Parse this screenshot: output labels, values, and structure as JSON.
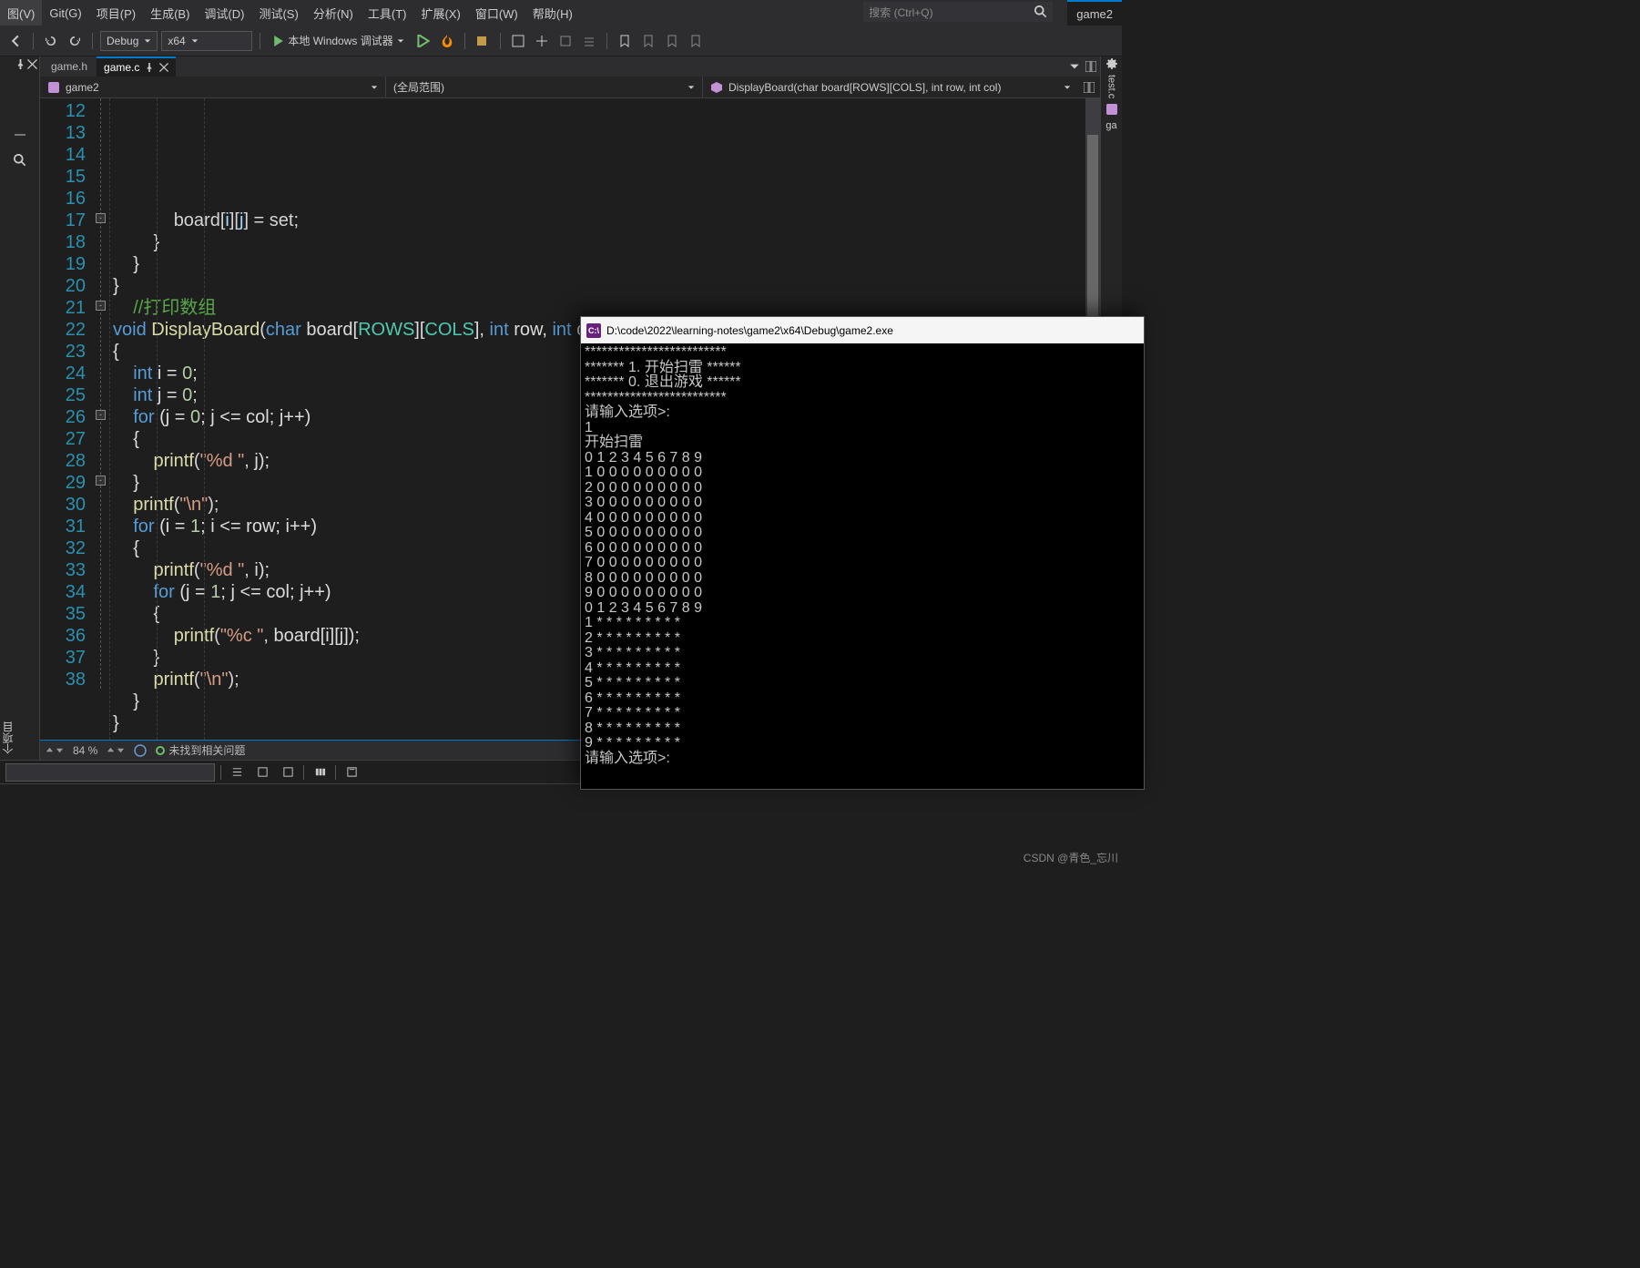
{
  "menu": {
    "items": [
      "图(V)",
      "Git(G)",
      "项目(P)",
      "生成(B)",
      "调试(D)",
      "测试(S)",
      "分析(N)",
      "工具(T)",
      "扩展(X)",
      "窗口(W)",
      "帮助(H)"
    ],
    "search_placeholder": "搜索 (Ctrl+Q)",
    "solution": "game2"
  },
  "toolbar": {
    "config": "Debug",
    "platform": "x64",
    "run_label": "本地 Windows 调试器"
  },
  "left": {
    "side_tab_label": "个项目"
  },
  "tabs": {
    "inactive": "game.h",
    "active": "game.c",
    "right_doc": "test.c",
    "right_prefix": "ga"
  },
  "nav": {
    "scope1": "game2",
    "scope2": "(全局范围)",
    "scope3": "DisplayBoard(char board[ROWS][COLS], int row, int col)"
  },
  "code": {
    "first_lineno": 12,
    "last_lineno": 38,
    "highlight_line": 27,
    "lines": [
      [
        [
          "",
          "            "
        ],
        [
          "wht",
          "board"
        ],
        [
          "wht",
          "["
        ],
        [
          "id",
          "i"
        ],
        [
          "wht",
          "]["
        ],
        [
          "id",
          "j"
        ],
        [
          "wht",
          "] = set;"
        ]
      ],
      [
        [
          "",
          "        }"
        ]
      ],
      [
        [
          "",
          "    }"
        ]
      ],
      [
        [
          "",
          "}"
        ]
      ],
      [
        [
          "",
          "    "
        ],
        [
          "cmt",
          "//打印数组"
        ]
      ],
      [
        [
          "kw",
          "void"
        ],
        [
          "",
          " "
        ],
        [
          "func",
          "DisplayBoard"
        ],
        [
          "wht",
          "("
        ],
        [
          "type",
          "char"
        ],
        [
          "",
          " board["
        ],
        [
          "cls",
          "ROWS"
        ],
        [
          "",
          "]["
        ],
        [
          "cls",
          "COLS"
        ],
        [
          "",
          "], "
        ],
        [
          "type",
          "int"
        ],
        [
          "",
          " row, "
        ],
        [
          "type",
          "int"
        ],
        [
          "",
          " col)"
        ]
      ],
      [
        [
          "",
          "{"
        ]
      ],
      [
        [
          "",
          "    "
        ],
        [
          "type",
          "int"
        ],
        [
          "",
          " i = "
        ],
        [
          "num",
          "0"
        ],
        [
          "",
          ";"
        ]
      ],
      [
        [
          "",
          "    "
        ],
        [
          "type",
          "int"
        ],
        [
          "",
          " j = "
        ],
        [
          "num",
          "0"
        ],
        [
          "",
          ";"
        ]
      ],
      [
        [
          "",
          "    "
        ],
        [
          "kw",
          "for"
        ],
        [
          "",
          " (j = "
        ],
        [
          "num",
          "0"
        ],
        [
          "",
          "; j <= col; j++)"
        ]
      ],
      [
        [
          "",
          "    {"
        ]
      ],
      [
        [
          "",
          "        "
        ],
        [
          "func",
          "printf"
        ],
        [
          "wht",
          "("
        ],
        [
          "str",
          "\"%d \""
        ],
        [
          "",
          ", j);"
        ]
      ],
      [
        [
          "",
          "    }"
        ]
      ],
      [
        [
          "",
          "    "
        ],
        [
          "func",
          "printf"
        ],
        [
          "wht",
          "("
        ],
        [
          "str",
          "\"\\n\""
        ],
        [
          "wht",
          ");"
        ]
      ],
      [
        [
          "",
          "    "
        ],
        [
          "kw",
          "for"
        ],
        [
          "",
          " (i = "
        ],
        [
          "num",
          "1"
        ],
        [
          "",
          "; i <= row; i++)"
        ]
      ],
      [
        [
          "",
          "    {"
        ]
      ],
      [
        [
          "",
          "        "
        ],
        [
          "func",
          "printf"
        ],
        [
          "wht",
          "("
        ],
        [
          "str",
          "\"%d \""
        ],
        [
          "",
          ", i);"
        ]
      ],
      [
        [
          "",
          "        "
        ],
        [
          "kw",
          "for"
        ],
        [
          "",
          " (j = "
        ],
        [
          "num",
          "1"
        ],
        [
          "",
          "; j <= col; j++)"
        ]
      ],
      [
        [
          "",
          "        {"
        ]
      ],
      [
        [
          "",
          "            "
        ],
        [
          "func",
          "printf"
        ],
        [
          "wht",
          "("
        ],
        [
          "str",
          "\"%c \""
        ],
        [
          "",
          ", board[i][j]);"
        ]
      ],
      [
        [
          "",
          "        }"
        ]
      ],
      [
        [
          "",
          "        "
        ],
        [
          "func",
          "printf"
        ],
        [
          "wht",
          "("
        ],
        [
          "str",
          "\"\\n\""
        ],
        [
          "wht",
          ");"
        ]
      ],
      [
        [
          "",
          "    }"
        ]
      ],
      [
        [
          "",
          ""
        ]
      ],
      [
        [
          "",
          "}"
        ]
      ],
      [
        [
          "",
          ""
        ]
      ],
      [
        [
          "",
          ""
        ]
      ]
    ],
    "fold_minus_lines": [
      17,
      21,
      26,
      29
    ]
  },
  "status": {
    "zoom": "84 %",
    "issues": "未找到相关问题"
  },
  "console": {
    "title": "D:\\code\\2022\\learning-notes\\game2\\x64\\Debug\\game2.exe",
    "lines": [
      "*************************",
      "******* 1. 开始扫雷 ******",
      "******* 0. 退出游戏 ******",
      "*************************",
      "请输入选项>:",
      "1",
      "开始扫雷",
      "0 1 2 3 4 5 6 7 8 9",
      "1 0 0 0 0 0 0 0 0 0",
      "2 0 0 0 0 0 0 0 0 0",
      "3 0 0 0 0 0 0 0 0 0",
      "4 0 0 0 0 0 0 0 0 0",
      "5 0 0 0 0 0 0 0 0 0",
      "6 0 0 0 0 0 0 0 0 0",
      "7 0 0 0 0 0 0 0 0 0",
      "8 0 0 0 0 0 0 0 0 0",
      "9 0 0 0 0 0 0 0 0 0",
      "0 1 2 3 4 5 6 7 8 9",
      "1 * * * * * * * * *",
      "2 * * * * * * * * *",
      "3 * * * * * * * * *",
      "4 * * * * * * * * *",
      "5 * * * * * * * * *",
      "6 * * * * * * * * *",
      "7 * * * * * * * * *",
      "8 * * * * * * * * *",
      "9 * * * * * * * * *",
      "请输入选项>:"
    ]
  },
  "watermark": "CSDN @青色_忘川"
}
